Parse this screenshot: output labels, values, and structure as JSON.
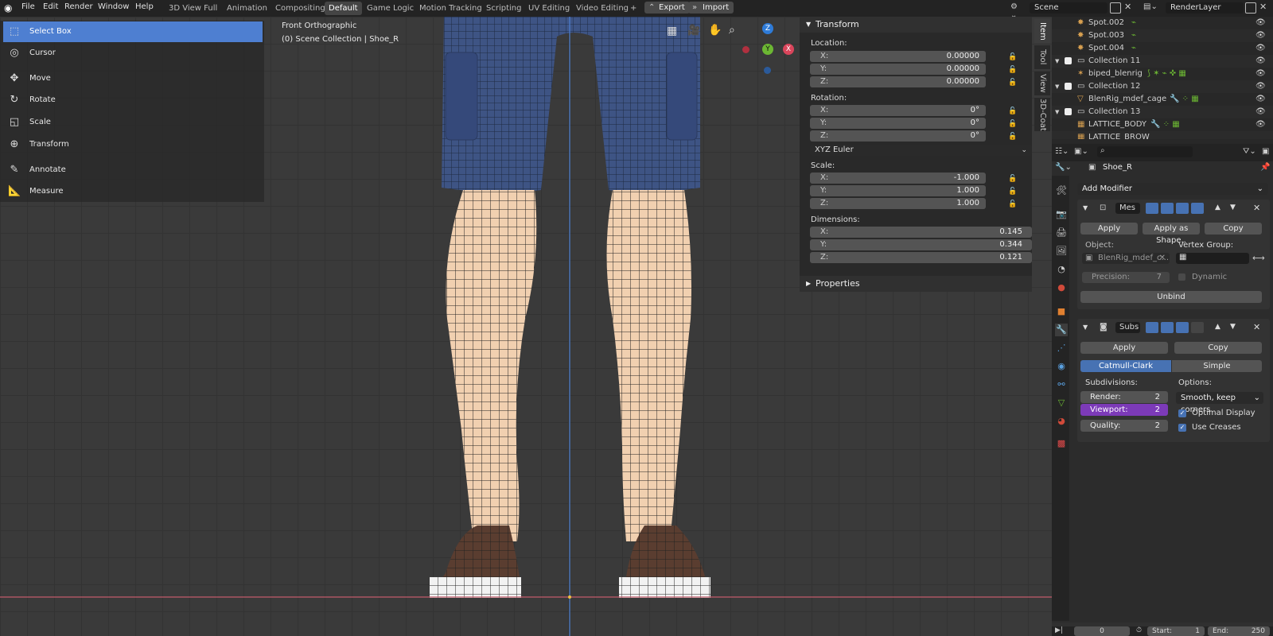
{
  "menu": [
    "File",
    "Edit",
    "Render",
    "Window",
    "Help"
  ],
  "workspaces": [
    {
      "label": "3D View Full"
    },
    {
      "label": "Animation"
    },
    {
      "label": "Compositing"
    },
    {
      "label": "Default",
      "active": true
    },
    {
      "label": "Game Logic"
    },
    {
      "label": "Motion Tracking"
    },
    {
      "label": "Scripting"
    },
    {
      "label": "UV Editing"
    },
    {
      "label": "Video Editing"
    }
  ],
  "add_tab": "+",
  "export_label": "Export",
  "import_label": "Import",
  "scene": "Scene",
  "render_layer": "RenderLayer",
  "viewport": {
    "view_name": "Front Orthographic",
    "collection_info": "(0) Scene Collection | Shoe_R",
    "gizmo": {
      "z": "Z",
      "y": "Y",
      "x": "X"
    }
  },
  "tools": [
    {
      "label": "Select Box",
      "icon": "select-box-icon",
      "active": true
    },
    {
      "label": "Cursor",
      "icon": "cursor-icon"
    },
    {
      "label": "Move",
      "icon": "move-icon"
    },
    {
      "label": "Rotate",
      "icon": "rotate-icon"
    },
    {
      "label": "Scale",
      "icon": "scale-icon"
    },
    {
      "label": "Transform",
      "icon": "transform-icon"
    },
    {
      "label": "Annotate",
      "icon": "annotate-icon"
    },
    {
      "label": "Measure",
      "icon": "measure-icon"
    }
  ],
  "npanel": {
    "title": "Transform",
    "location_label": "Location:",
    "location": [
      {
        "ax": "X:",
        "val": "0.00000"
      },
      {
        "ax": "Y:",
        "val": "0.00000"
      },
      {
        "ax": "Z:",
        "val": "0.00000"
      }
    ],
    "rotation_label": "Rotation:",
    "rotation": [
      {
        "ax": "X:",
        "val": "0°"
      },
      {
        "ax": "Y:",
        "val": "0°"
      },
      {
        "ax": "Z:",
        "val": "0°"
      }
    ],
    "rotation_mode": "XYZ Euler",
    "scale_label": "Scale:",
    "scale": [
      {
        "ax": "X:",
        "val": "-1.000"
      },
      {
        "ax": "Y:",
        "val": "1.000"
      },
      {
        "ax": "Z:",
        "val": "1.000"
      }
    ],
    "dimensions_label": "Dimensions:",
    "dimensions": [
      {
        "ax": "X:",
        "val": "0.145"
      },
      {
        "ax": "Y:",
        "val": "0.344"
      },
      {
        "ax": "Z:",
        "val": "0.121"
      }
    ],
    "properties_label": "Properties"
  },
  "side_tabs": [
    "Item",
    "Tool",
    "View",
    "3D-Coat"
  ],
  "outliner": [
    {
      "label": "Spot.002"
    },
    {
      "label": "Spot.003"
    },
    {
      "label": "Spot.004"
    },
    {
      "label": "Collection 11"
    },
    {
      "label": "biped_blenrig"
    },
    {
      "label": "Collection 12"
    },
    {
      "label": "BlenRig_mdef_cage"
    },
    {
      "label": "Collection 13"
    },
    {
      "label": "LATTICE_BODY"
    },
    {
      "label": "LATTICE_BROW"
    }
  ],
  "properties": {
    "object_name": "Shoe_R",
    "add_modifier": "Add Modifier",
    "mod1": {
      "name": "Mes",
      "apply": "Apply",
      "apply_shape": "Apply as Shape..",
      "copy": "Copy",
      "object_label": "Object:",
      "object_value": "BlenRig_mdef_c...",
      "vgroup_label": "Vertex Group:",
      "precision_label": "Precision:",
      "precision": "7",
      "dynamic": "Dynamic",
      "unbind": "Unbind"
    },
    "mod2": {
      "name": "Subs",
      "apply": "Apply",
      "copy": "Copy",
      "catmull": "Catmull-Clark",
      "simple": "Simple",
      "subdivisions_label": "Subdivisions:",
      "options_label": "Options:",
      "render_label": "Render:",
      "render": "2",
      "viewport_label": "Viewport:",
      "viewport": "2",
      "quality_label": "Quality:",
      "quality": "2",
      "uv_mode": "Smooth, keep corners",
      "optimal": "Optimal Display",
      "creases": "Use Creases"
    }
  },
  "timeline": {
    "frame": "0",
    "start_label": "Start:",
    "start": "1",
    "end_label": "End:",
    "end": "250"
  },
  "colors": {
    "accent": "#4772b3",
    "selected_tool": "#4e7fd1",
    "viewport_highlight": "#7c3ab8",
    "skin": "#f1d0b0"
  }
}
